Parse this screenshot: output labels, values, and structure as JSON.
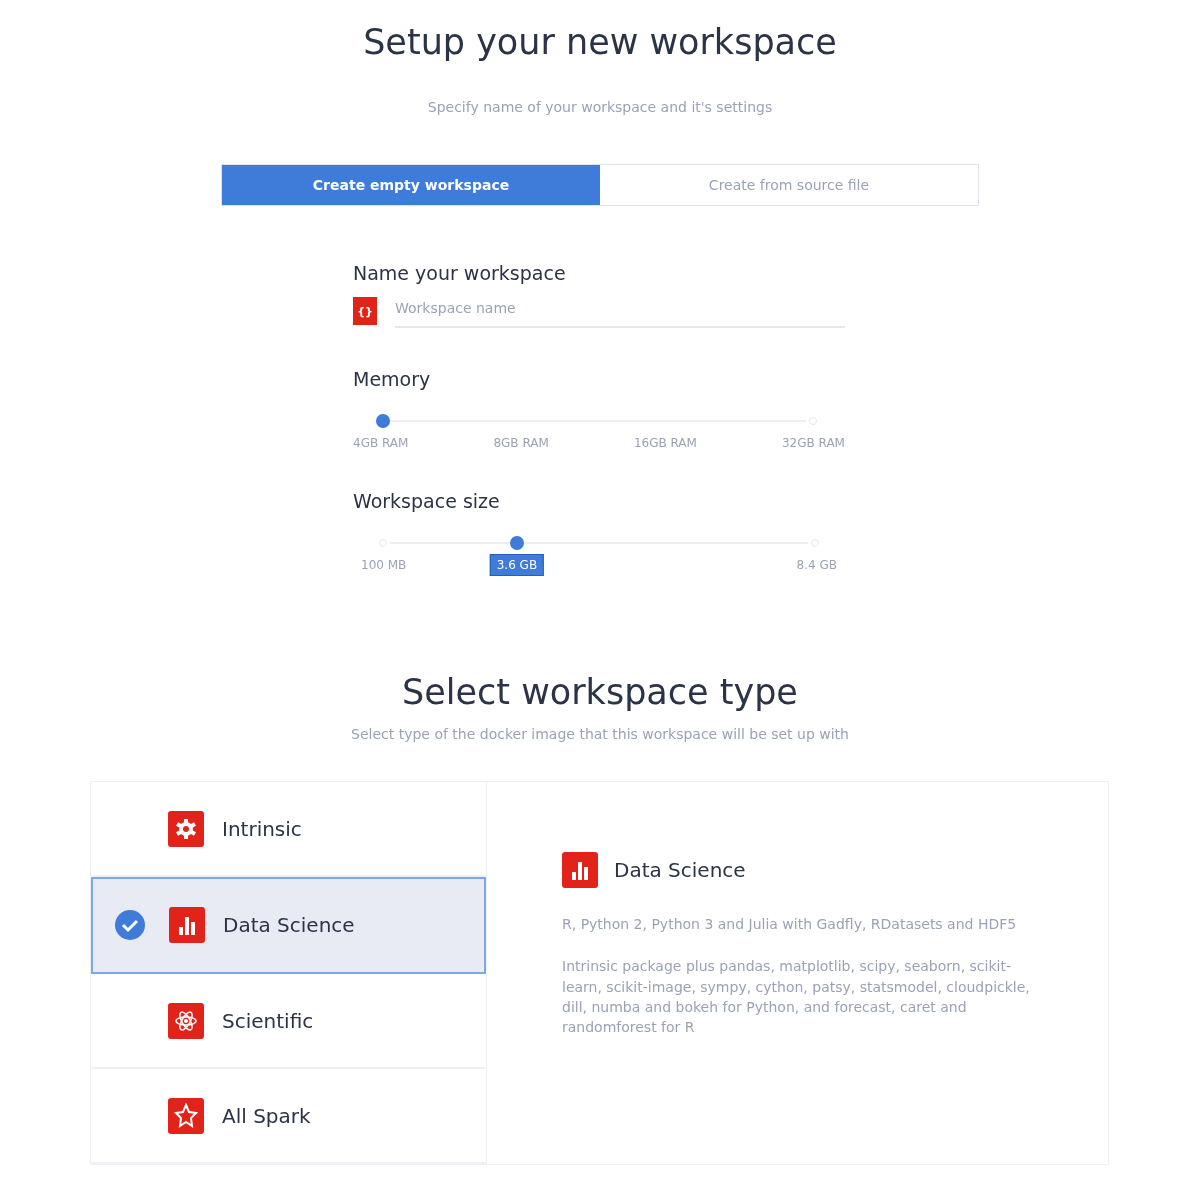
{
  "header": {
    "title": "Setup your new workspace",
    "subtitle": "Specify name of your workspace and it's settings"
  },
  "tabs": [
    {
      "label": "Create empty workspace",
      "selected": true
    },
    {
      "label": "Create from source file",
      "selected": false
    }
  ],
  "name_field": {
    "label": "Name your workspace",
    "placeholder": "Workspace name",
    "icon_text": "{}"
  },
  "memory": {
    "label": "Memory",
    "level": 0,
    "stops": [
      "4GB RAM",
      "8GB RAM",
      "16GB RAM",
      "32GB RAM"
    ]
  },
  "size": {
    "label": "Workspace size",
    "level": 0.31,
    "value": "3.6 GB",
    "min": "100 MB",
    "max": "8.4 GB"
  },
  "type_section": {
    "title": "Select workspace type",
    "subtitle": "Select type of the docker image that this workspace will be set up  with"
  },
  "types": [
    {
      "label": "Intrinsic",
      "selected": false
    },
    {
      "label": "Data Science",
      "selected": true
    },
    {
      "label": "Scientific",
      "selected": false
    },
    {
      "label": "All Spark",
      "selected": false
    }
  ],
  "detail": {
    "title": "Data Science",
    "languages": "R, Python 2, Python 3 and Julia with Gadfly, RDatasets and HDF5",
    "packages": "Intrinsic package plus pandas, matplotlib, scipy, seaborn, scikit-learn, scikit-image, sympy, cython, patsy, statsmodel, cloudpickle, dill, numba and bokeh for Python, and forecast, caret and randomforest for R"
  }
}
